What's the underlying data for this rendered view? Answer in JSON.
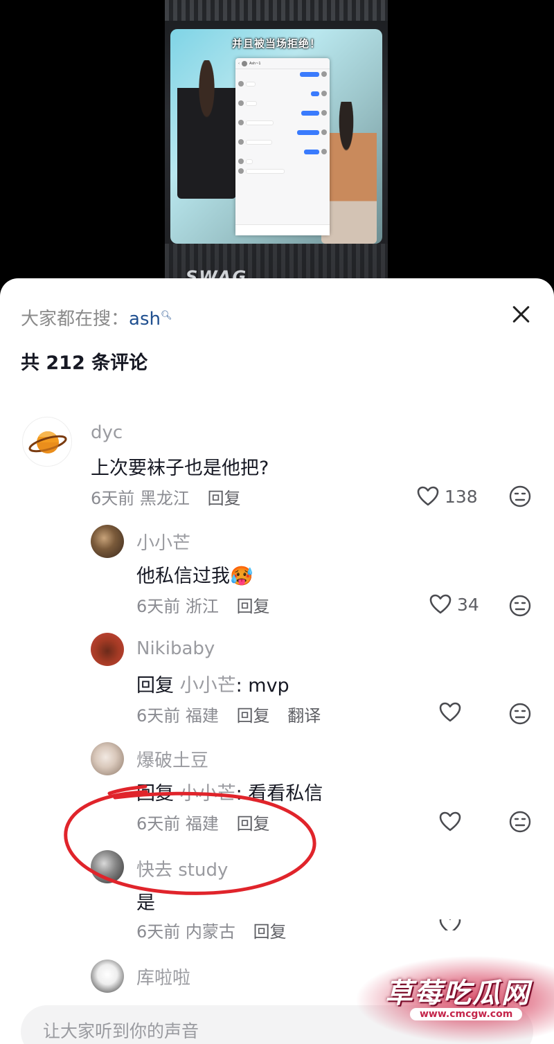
{
  "video": {
    "caption": "并且被当场拒绝！",
    "brand_text": "SWAG",
    "dm_header_name": "Ash~1"
  },
  "header": {
    "hot_search_prefix": "大家都在搜：",
    "hot_search_keyword": "ash",
    "comment_count": "共 212 条评论"
  },
  "comments": [
    {
      "user": "dyc",
      "text": "上次要袜子也是他把?",
      "time": "6天前",
      "location": "黑龙江",
      "reply_label": "回复",
      "likes": "138"
    },
    {
      "user": "小小芒",
      "text": "他私信过我🥵",
      "time": "6天前",
      "location": "浙江",
      "reply_label": "回复",
      "likes": "34"
    },
    {
      "user": "Nikibaby",
      "reply_prefix": "回复",
      "reply_to": "小小芒",
      "text": ": mvp",
      "time": "6天前",
      "location": "福建",
      "reply_label": "回复",
      "translate_label": "翻译",
      "likes": ""
    },
    {
      "user": "爆破土豆",
      "reply_prefix": "回复",
      "reply_to": "小小芒",
      "text": ": 看看私信",
      "time": "6天前",
      "location": "福建",
      "reply_label": "回复",
      "likes": ""
    },
    {
      "user": "快去 study",
      "text": "是",
      "time": "6天前",
      "location": "内蒙古",
      "reply_label": "回复",
      "likes": ""
    },
    {
      "user": "库啦啦"
    }
  ],
  "input": {
    "placeholder": "让大家听到你的声音"
  },
  "watermark": {
    "title": "草莓吃瓜网",
    "url": "www.cmcgw.com"
  },
  "colors": {
    "annotation_red": "#e0242b",
    "keyword_blue": "#1f4f8f"
  }
}
